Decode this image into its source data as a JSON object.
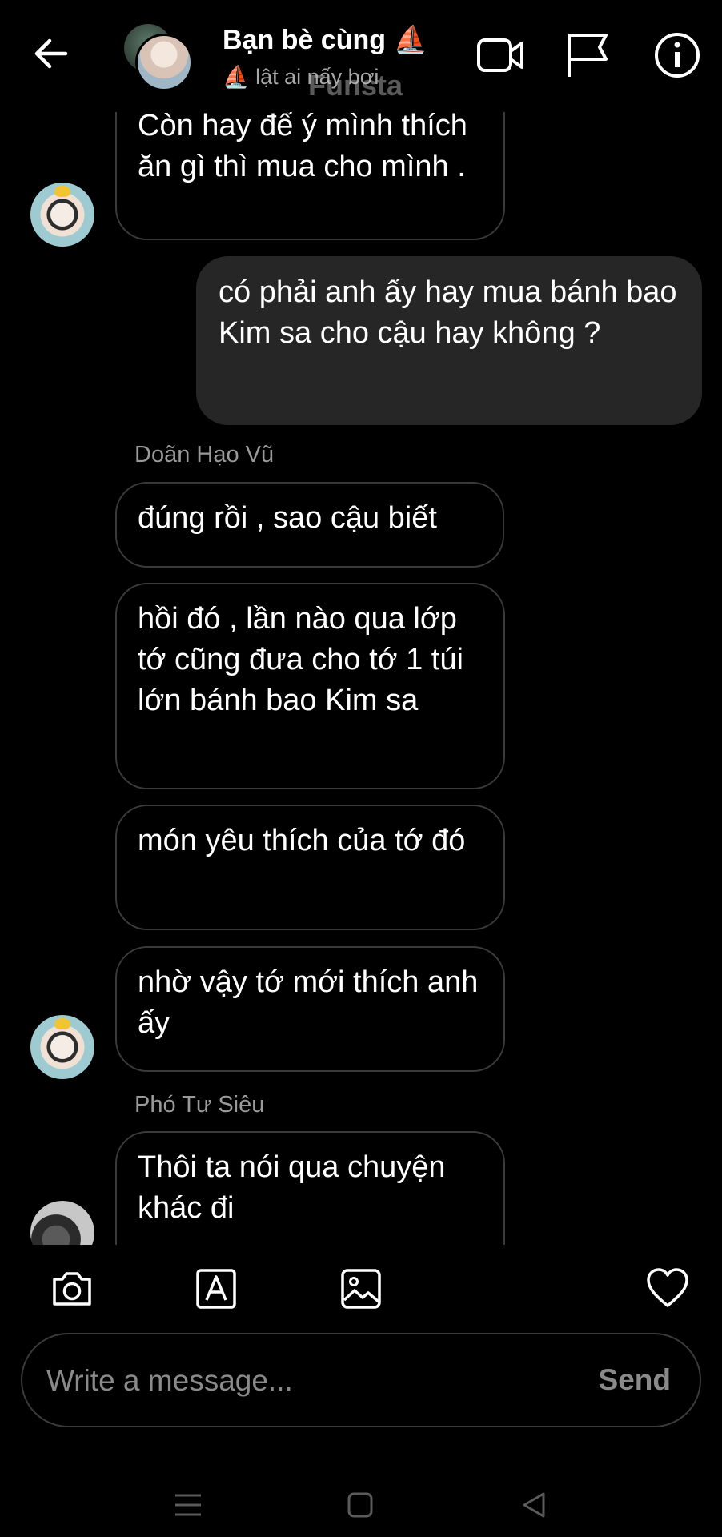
{
  "header": {
    "title": "Bạn bè cùng ⛵",
    "subtitle": "⛵ lật ai nấy bơi",
    "watermark": "Funsta"
  },
  "messages": {
    "m0": "Còn hay để ý mình thích ăn gì thì mua cho mình .",
    "m1": "có phải anh ấy hay mua bánh bao Kim sa cho cậu hay không ?",
    "sender1": "Doãn Hạo Vũ",
    "m2": "đúng rồi , sao cậu biết",
    "m3": "hồi đó , lần nào qua lớp tớ cũng đưa cho tớ 1 túi lớn bánh bao Kim sa",
    "m4": "món yêu thích của tớ đó",
    "m5": "nhờ vậy tớ mới thích anh ấy",
    "sender2": "Phó Tư Siêu",
    "m6": "Thôi ta nói qua chuyện khác đi"
  },
  "composer": {
    "placeholder": "Write a message...",
    "send_label": "Send"
  },
  "icons": {
    "back": "arrow-left-icon",
    "video": "video-camera-icon",
    "report": "flag-icon",
    "info": "info-icon",
    "camera": "camera-icon",
    "sticker": "text-sticker-icon",
    "gallery": "image-icon",
    "like": "heart-icon"
  }
}
